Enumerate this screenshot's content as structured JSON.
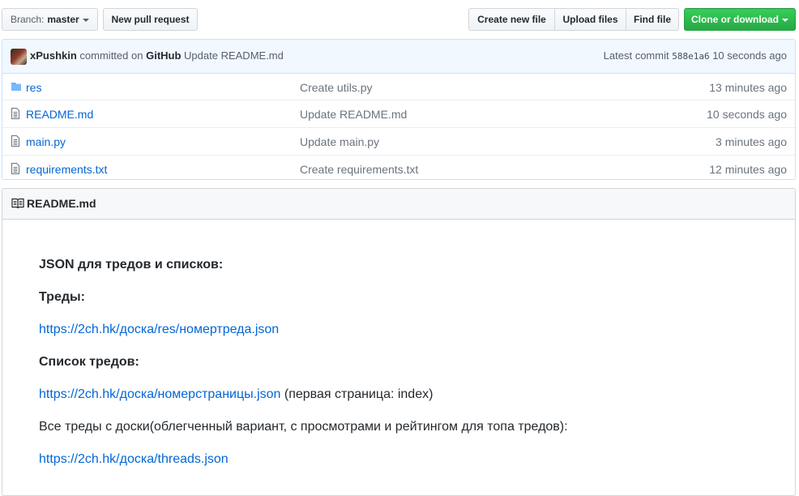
{
  "toolbar": {
    "branch_prefix": "Branch:",
    "branch_name": "master",
    "new_pull_request": "New pull request",
    "create_new_file": "Create new file",
    "upload_files": "Upload files",
    "find_file": "Find file",
    "clone_or_download": "Clone or download"
  },
  "commit": {
    "author": "xPushkin",
    "committed_on": "committed on",
    "platform": "GitHub",
    "message": "Update README.md",
    "latest_label": "Latest commit",
    "sha": "588e1a6",
    "age": "10 seconds ago"
  },
  "files": [
    {
      "type": "folder",
      "name": "res",
      "message": "Create utils.py",
      "age": "13 minutes ago"
    },
    {
      "type": "file",
      "name": "README.md",
      "message": "Update README.md",
      "age": "10 seconds ago"
    },
    {
      "type": "file",
      "name": "main.py",
      "message": "Update main.py",
      "age": "3 minutes ago"
    },
    {
      "type": "file",
      "name": "requirements.txt",
      "message": "Create requirements.txt",
      "age": "12 minutes ago"
    }
  ],
  "readme": {
    "title": "README.md",
    "heading_json": "JSON для тредов и списков:",
    "heading_threads": "Треды:",
    "link_thread": "https://2ch.hk/доска/res/номертреда.json",
    "heading_thread_list": "Список тредов:",
    "link_page": "https://2ch.hk/доска/номерстраницы.json",
    "page_note": " (первая страница: index)",
    "all_threads_text": "Все треды с доски(облегченный вариант, с просмотрами и рейтингом для топа тредов):",
    "link_threads": "https://2ch.hk/доска/threads.json"
  },
  "colors": {
    "link": "#0366d6",
    "clone_button": "#28a745",
    "commit_bar": "#f1f8ff"
  }
}
